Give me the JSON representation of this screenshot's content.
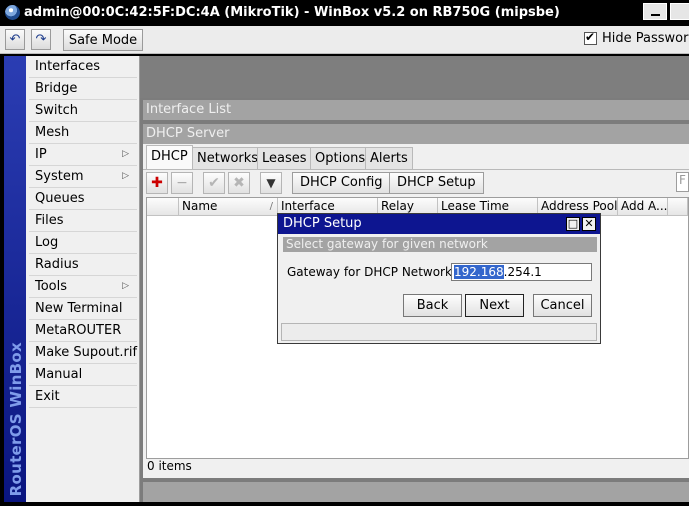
{
  "window": {
    "title": "admin@00:0C:42:5F:DC:4A (MikroTik) - WinBox v5.2 on RB750G (mipsbe)"
  },
  "toolbar": {
    "undo_icon": "↶",
    "redo_icon": "↷",
    "safe_mode_label": "Safe Mode",
    "hide_passwords_label": "Hide Passwords",
    "hide_passwords_checked": true
  },
  "brand": {
    "text": "RouterOS WinBox"
  },
  "menu": {
    "items": [
      {
        "label": "Interfaces",
        "submenu": false
      },
      {
        "label": "Bridge",
        "submenu": false
      },
      {
        "label": "Switch",
        "submenu": false
      },
      {
        "label": "Mesh",
        "submenu": false
      },
      {
        "label": "IP",
        "submenu": true
      },
      {
        "label": "System",
        "submenu": true
      },
      {
        "label": "Queues",
        "submenu": false
      },
      {
        "label": "Files",
        "submenu": false
      },
      {
        "label": "Log",
        "submenu": false
      },
      {
        "label": "Radius",
        "submenu": false
      },
      {
        "label": "Tools",
        "submenu": true
      },
      {
        "label": "New Terminal",
        "submenu": false
      },
      {
        "label": "MetaROUTER",
        "submenu": false
      },
      {
        "label": "Make Supout.rif",
        "submenu": false
      },
      {
        "label": "Manual",
        "submenu": false
      },
      {
        "label": "Exit",
        "submenu": false
      }
    ],
    "submenu_arrow": "▷"
  },
  "interface_list": {
    "title": "Interface List"
  },
  "dhcp_server": {
    "title": "DHCP Server",
    "tabs": [
      "DHCP",
      "Networks",
      "Leases",
      "Options",
      "Alerts"
    ],
    "active_tab": "DHCP",
    "buttons": {
      "add_icon": "✚",
      "remove_icon": "−",
      "enable_icon": "✔",
      "disable_icon": "✖",
      "filter_icon": "▼",
      "dhcp_config_label": "DHCP Config",
      "dhcp_setup_label": "DHCP Setup"
    },
    "find_placeholder": "F",
    "columns": [
      "Name",
      "Interface",
      "Relay",
      "Lease Time",
      "Address Pool",
      "Add A..."
    ],
    "sort_indicator": "/",
    "rows": [],
    "status": "0 items"
  },
  "dialog": {
    "title": "DHCP Setup",
    "restore_icon": "□",
    "close_icon": "✕",
    "subtitle": "Select gateway for given network",
    "gateway_label": "Gateway for DHCP Network:",
    "gateway_selected": "192.168",
    "gateway_rest": ".254.1",
    "back_label": "Back",
    "next_label": "Next",
    "cancel_label": "Cancel"
  },
  "colors": {
    "titlebar": "#000000",
    "dialog_title": "#0d1590",
    "selection": "#3366cc",
    "add_icon": "#cc0000",
    "brand_strip": "#0e1a90"
  }
}
